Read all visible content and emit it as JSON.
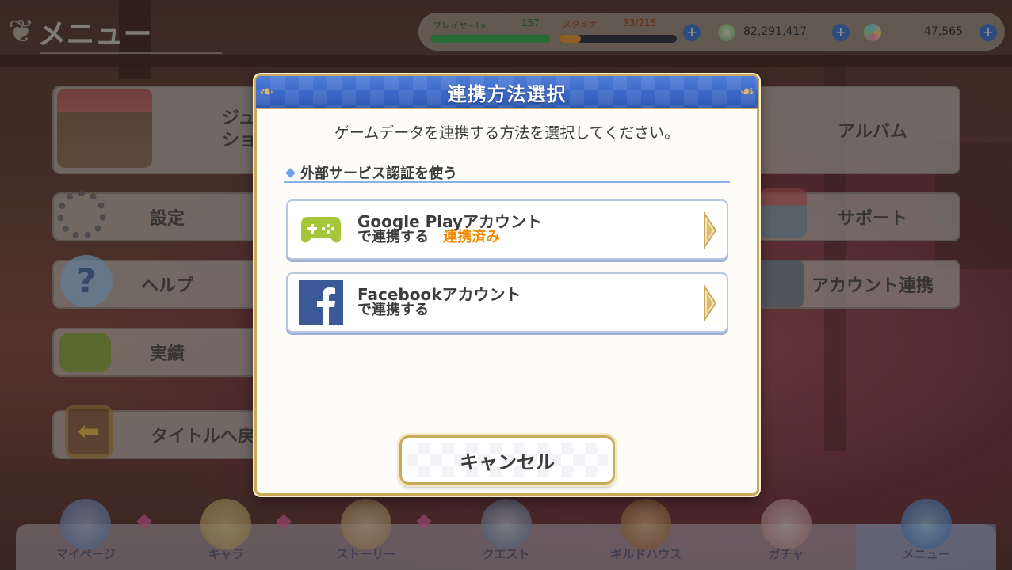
{
  "header": {
    "menu_title": "メニュー",
    "status": {
      "level_label": "プレイヤーLv",
      "level_value": "157",
      "stamina_label": "スタミナ",
      "stamina_value": "33/215",
      "mana": "82,291,417",
      "gems": "47,565"
    }
  },
  "side_menu": {
    "left": [
      {
        "label": "ジュ\nショ"
      },
      {
        "label": "設定"
      },
      {
        "label": "ヘルプ"
      },
      {
        "label": "実績"
      },
      {
        "label": "タイトルへ戻る"
      }
    ],
    "right": [
      {
        "label": "アルバム"
      },
      {
        "label": "サポート"
      },
      {
        "label": "アカウント連携"
      }
    ]
  },
  "bottom_nav": [
    {
      "label": "マイページ"
    },
    {
      "label": "キャラ"
    },
    {
      "label": "ストーリー"
    },
    {
      "label": "クエスト"
    },
    {
      "label": "ギルドハウス"
    },
    {
      "label": "ガチャ"
    },
    {
      "label": "メニュー"
    }
  ],
  "dialog": {
    "title": "連携方法選択",
    "subtitle": "ゲームデータを連携する方法を選択してください。",
    "section_label": "外部サービス認証を使う",
    "google": {
      "line1": "Google Playアカウント",
      "line2": "で連携する",
      "status": "連携済み"
    },
    "facebook": {
      "line1": "Facebookアカウント",
      "line2": "で連携する"
    },
    "cancel_label": "キャンセル"
  },
  "colors": {
    "header_blue": "#3b68c8",
    "gold_border": "#c9a95a",
    "linked_orange": "#f08a00",
    "google_green": "#a4c639",
    "facebook_blue": "#3b5998"
  }
}
